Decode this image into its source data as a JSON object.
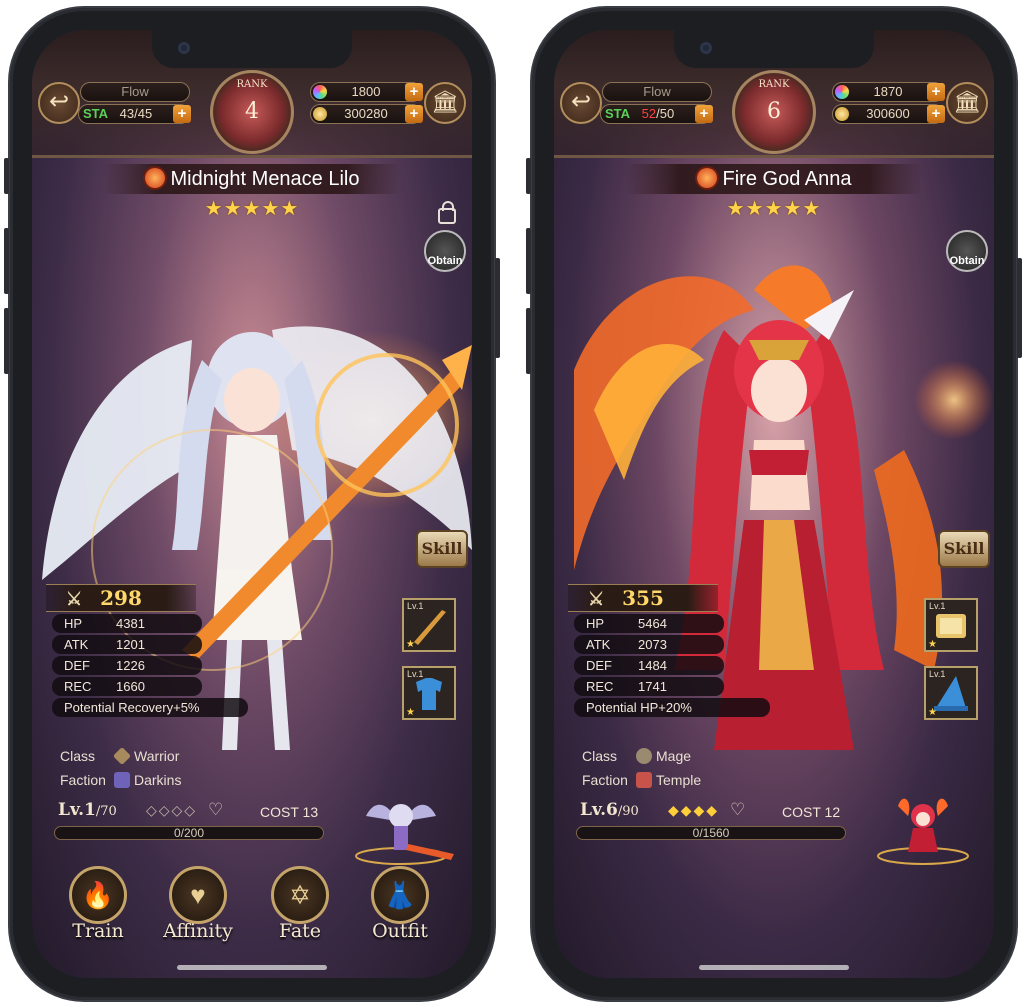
{
  "left": {
    "flow": "Flow",
    "sta_label": "STA",
    "sta_current": "43",
    "sta_max": "/45",
    "rank_label": "RANK",
    "rank": "4",
    "gems": "1800",
    "gold": "300280",
    "name": "Midnight Menace Lilo",
    "stars": "★★★★★",
    "obtain": "Obtain",
    "skill": "Skill",
    "power": "298",
    "stats": [
      {
        "key": "HP",
        "value": "4381"
      },
      {
        "key": "ATK",
        "value": "1201"
      },
      {
        "key": "DEF",
        "value": "1226"
      },
      {
        "key": "REC",
        "value": "1660"
      }
    ],
    "potential": "Potential Recovery+5%",
    "class_label": "Class",
    "class_value": "Warrior",
    "faction_label": "Faction",
    "faction_value": "Darkins",
    "level_main": "Lv.1",
    "level_max": "/70",
    "diamonds": "◇◇◇◇",
    "cost": "COST 13",
    "exp": "0/200",
    "equip1_lv": "Lv.1",
    "equip2_lv": "Lv.1",
    "menu": [
      "Train",
      "Affinity",
      "Fate",
      "Outfit"
    ]
  },
  "right": {
    "flow": "Flow",
    "sta_label": "STA",
    "sta_current": "52",
    "sta_max": "/50",
    "rank_label": "RANK",
    "rank": "6",
    "gems": "1870",
    "gold": "300600",
    "name": "Fire God Anna",
    "stars": "★★★★★",
    "obtain": "Obtain",
    "skill": "Skill",
    "power": "355",
    "stats": [
      {
        "key": "HP",
        "value": "5464"
      },
      {
        "key": "ATK",
        "value": "2073"
      },
      {
        "key": "DEF",
        "value": "1484"
      },
      {
        "key": "REC",
        "value": "1741"
      }
    ],
    "potential": "Potential HP+20%",
    "class_label": "Class",
    "class_value": "Mage",
    "faction_label": "Faction",
    "faction_value": "Temple",
    "level_main": "Lv.6",
    "level_max": "/90",
    "diamonds": "◆◆◆◆",
    "cost": "COST 12",
    "exp": "0/1560",
    "equip1_lv": "Lv.1",
    "equip2_lv": "Lv.1"
  }
}
